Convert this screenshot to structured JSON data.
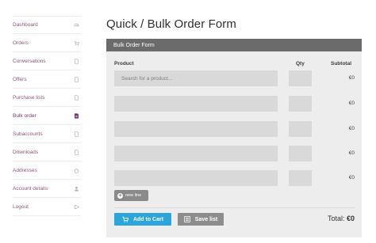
{
  "sidebar": {
    "items": [
      {
        "label": "Dashboard",
        "icon": "dashboard-icon",
        "active": false
      },
      {
        "label": "Orders",
        "icon": "cart-icon",
        "active": false
      },
      {
        "label": "Conversations",
        "icon": "document-icon",
        "active": false
      },
      {
        "label": "Offers",
        "icon": "document-icon",
        "active": false
      },
      {
        "label": "Purchase lists",
        "icon": "document-icon",
        "active": false
      },
      {
        "label": "Bulk order",
        "icon": "document-icon",
        "active": true
      },
      {
        "label": "Subaccounts",
        "icon": "document-icon",
        "active": false
      },
      {
        "label": "Downloads",
        "icon": "document-icon",
        "active": false
      },
      {
        "label": "Addresses",
        "icon": "home-icon",
        "active": false
      },
      {
        "label": "Account details",
        "icon": "user-icon",
        "active": false
      },
      {
        "label": "Logout",
        "icon": "logout-icon",
        "active": false
      }
    ]
  },
  "page": {
    "title": "Quick / Bulk Order Form"
  },
  "form": {
    "header": "Bulk Order Form",
    "columns": {
      "product": "Product",
      "qty": "Qty",
      "subtotal": "Subtotal"
    },
    "search_placeholder": "Search for a product...",
    "rows": [
      {
        "product": "",
        "qty": "",
        "subtotal": "€0"
      },
      {
        "product": "",
        "qty": "",
        "subtotal": "€0"
      },
      {
        "product": "",
        "qty": "",
        "subtotal": "€0"
      },
      {
        "product": "",
        "qty": "",
        "subtotal": "€0"
      },
      {
        "product": "",
        "qty": "",
        "subtotal": "€0"
      }
    ],
    "new_line_label": "new line",
    "add_to_cart_label": "Add to Cart",
    "save_list_label": "Save list",
    "total_label": "Total:",
    "total_value": "€0"
  },
  "colors": {
    "accent_blue": "#2ba5dd",
    "nav_text": "#8e5478",
    "header_bar": "#6b6b6b"
  }
}
